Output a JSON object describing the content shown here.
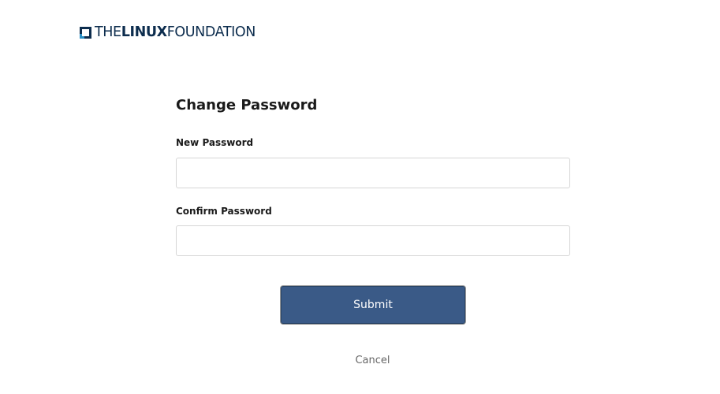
{
  "logo": {
    "text_thin_left": "THE",
    "text_bold": "LINUX",
    "text_thin_right": "FOUNDATION",
    "mark_icon": "linux-foundation-bracket-icon",
    "color": "#0d2d4e",
    "mark_accent": "#2a8fc5"
  },
  "form": {
    "title": "Change Password",
    "new_password_label": "New Password",
    "new_password_value": "",
    "confirm_password_label": "Confirm Password",
    "confirm_password_value": "",
    "submit_label": "Submit",
    "cancel_label": "Cancel"
  },
  "colors": {
    "submit_bg": "#3a5a87",
    "text": "#1a1a1a",
    "muted": "#666666",
    "input_border": "#d6d6d6"
  }
}
